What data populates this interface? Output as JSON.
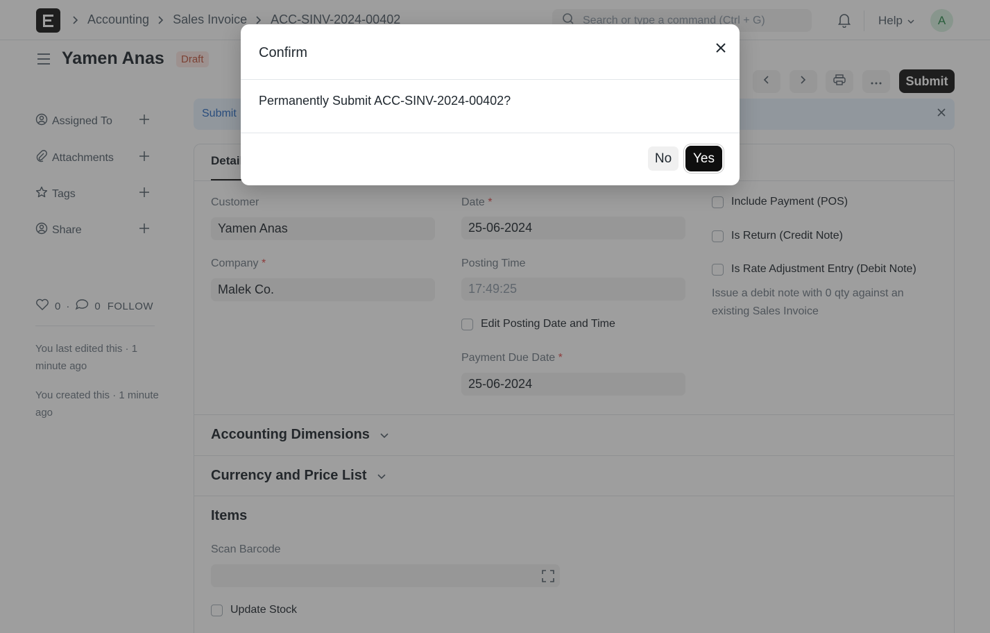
{
  "navbar": {
    "breadcrumbs": [
      "Accounting",
      "Sales Invoice",
      "ACC-SINV-2024-00402"
    ],
    "search_placeholder": "Search or type a command (Ctrl + G)",
    "help_label": "Help",
    "avatar_letter": "A"
  },
  "page": {
    "title": "Yamen Anas",
    "status": "Draft",
    "submit_label": "Submit"
  },
  "sidebar": {
    "items": [
      {
        "label": "Assigned To",
        "icon": "user-circle-icon"
      },
      {
        "label": "Attachments",
        "icon": "paperclip-icon"
      },
      {
        "label": "Tags",
        "icon": "star-icon"
      },
      {
        "label": "Share",
        "icon": "user-circle-icon"
      }
    ],
    "likes": "0",
    "comments": "0",
    "follow_label": "FOLLOW",
    "edited_note": "You last edited this · 1 minute ago",
    "created_note": "You created this · 1 minute ago"
  },
  "alert": {
    "text": "Submit"
  },
  "form": {
    "tab_label": "Details",
    "customer": {
      "label": "Customer",
      "value": "Yamen Anas"
    },
    "company": {
      "label": "Company",
      "value": "Malek Co."
    },
    "date": {
      "label": "Date",
      "value": "25-06-2024"
    },
    "posting_time": {
      "label": "Posting Time",
      "value": "17:49:25"
    },
    "edit_posting": "Edit Posting Date and Time",
    "due_date": {
      "label": "Payment Due Date",
      "value": "25-06-2024"
    },
    "include_payment": "Include Payment (POS)",
    "is_return": "Is Return (Credit Note)",
    "rate_adjustment": "Is Rate Adjustment Entry (Debit Note)",
    "rate_adjustment_help": "Issue a debit note with 0 qty against an existing Sales Invoice",
    "required_mark": "*"
  },
  "sections": {
    "accounting_dimensions": "Accounting Dimensions",
    "currency_price_list": "Currency and Price List",
    "items": "Items",
    "scan_barcode": "Scan Barcode",
    "update_stock": "Update Stock"
  },
  "modal": {
    "title": "Confirm",
    "message": "Permanently Submit ACC-SINV-2024-00402?",
    "no_label": "No",
    "yes_label": "Yes"
  }
}
